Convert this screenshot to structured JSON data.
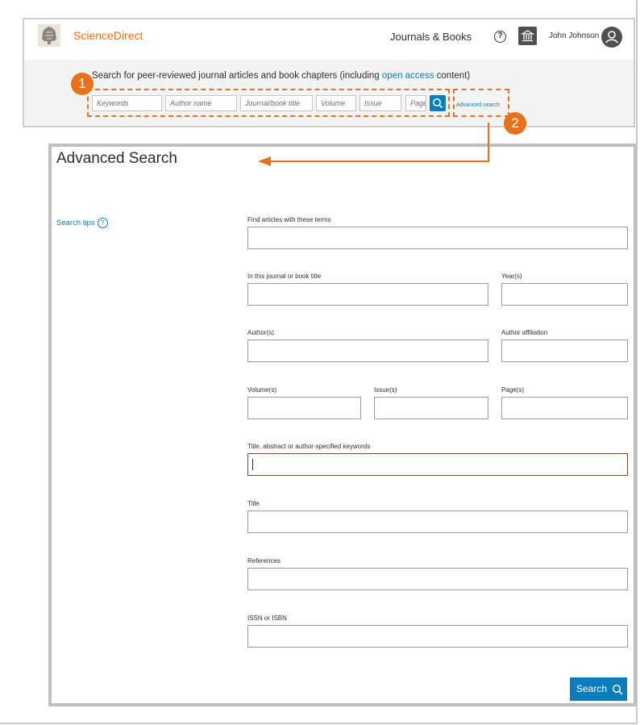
{
  "header": {
    "brand": "ScienceDirect",
    "nav_journals": "Journals & Books",
    "help_icon": "?",
    "user_name": "John Johnson"
  },
  "quick_search": {
    "description_pre": "Search for peer-reviewed journal articles and book chapters (including ",
    "description_link": "open access",
    "description_post": " content)",
    "placeholders": {
      "keywords": "Keywords",
      "author": "Author name",
      "journal": "Journal/book title",
      "volume": "Volume",
      "issue": "Issue",
      "pages": "Pages"
    },
    "advanced_link": "Advanced search"
  },
  "annotations": {
    "step1": "1",
    "step2": "2"
  },
  "advanced": {
    "title": "Advanced Search",
    "search_tips": "Search tips",
    "tips_icon": "?",
    "labels": {
      "terms": "Find articles with these terms",
      "journal": "In this journal or book title",
      "years": "Year(s)",
      "authors": "Author(s)",
      "affiliation": "Author affiliation",
      "volume": "Volume(s)",
      "issue": "Issue(s)",
      "pages": "Page(s)",
      "keywords": "Title, abstract or author-specified keywords",
      "title": "Title",
      "references": "References",
      "issn": "ISSN or ISBN"
    },
    "submit": "Search"
  },
  "colors": {
    "accent": "#e9711c",
    "link": "#0c7dbb",
    "field_focus": "#8a4b1d"
  }
}
